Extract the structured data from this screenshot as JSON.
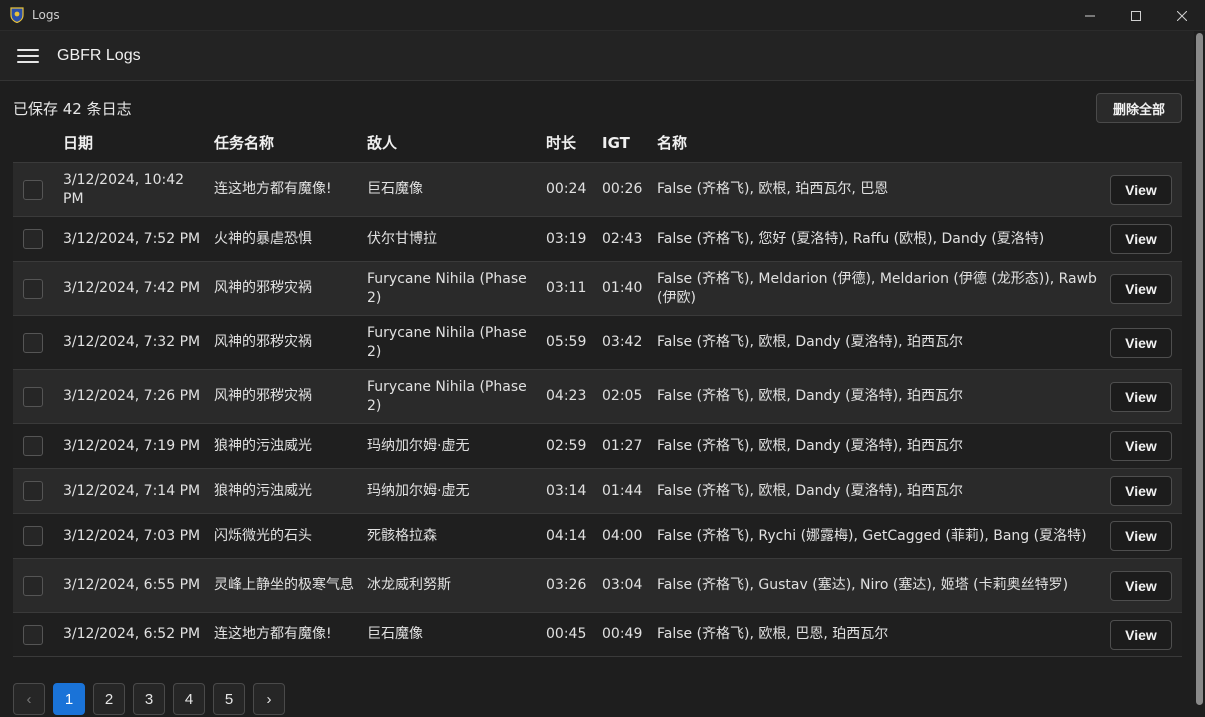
{
  "window": {
    "title": "Logs",
    "controls": {
      "minimize": "—",
      "maximize": "☐",
      "close": "✕"
    }
  },
  "appbar": {
    "title": "GBFR Logs"
  },
  "summary": {
    "saved_count_text": "已保存 42 条日志",
    "delete_all_label": "删除全部"
  },
  "table": {
    "headers": {
      "date": "日期",
      "quest": "任务名称",
      "enemy": "敌人",
      "duration": "时长",
      "igt": "IGT",
      "name": "名称"
    },
    "view_label": "View",
    "rows": [
      {
        "date": "3/12/2024, 10:42 PM",
        "quest": "连这地方都有魔像!",
        "enemy": "巨石魔像",
        "duration": "00:24",
        "igt": "00:26",
        "name": "False (齐格飞), 欧根, 珀西瓦尔, 巴恩"
      },
      {
        "date": "3/12/2024, 7:52 PM",
        "quest": "火神的暴虐恐惧",
        "enemy": "伏尔甘博拉",
        "duration": "03:19",
        "igt": "02:43",
        "name": "False (齐格飞), 您好 (夏洛特), Raffu (欧根), Dandy (夏洛特)"
      },
      {
        "date": "3/12/2024, 7:42 PM",
        "quest": "风神的邪秽灾祸",
        "enemy": "Furycane Nihila (Phase 2)",
        "duration": "03:11",
        "igt": "01:40",
        "name": "False (齐格飞), Meldarion (伊德), Meldarion (伊德 (龙形态)), Rawb (伊欧)"
      },
      {
        "date": "3/12/2024, 7:32 PM",
        "quest": "风神的邪秽灾祸",
        "enemy": "Furycane Nihila (Phase 2)",
        "duration": "05:59",
        "igt": "03:42",
        "name": "False (齐格飞), 欧根, Dandy (夏洛特), 珀西瓦尔"
      },
      {
        "date": "3/12/2024, 7:26 PM",
        "quest": "风神的邪秽灾祸",
        "enemy": "Furycane Nihila (Phase 2)",
        "duration": "04:23",
        "igt": "02:05",
        "name": "False (齐格飞), 欧根, Dandy (夏洛特), 珀西瓦尔"
      },
      {
        "date": "3/12/2024, 7:19 PM",
        "quest": "狼神的污浊威光",
        "enemy": "玛纳加尔姆·虚无",
        "duration": "02:59",
        "igt": "01:27",
        "name": "False (齐格飞), 欧根, Dandy (夏洛特), 珀西瓦尔"
      },
      {
        "date": "3/12/2024, 7:14 PM",
        "quest": "狼神的污浊威光",
        "enemy": "玛纳加尔姆·虚无",
        "duration": "03:14",
        "igt": "01:44",
        "name": "False (齐格飞), 欧根, Dandy (夏洛特), 珀西瓦尔"
      },
      {
        "date": "3/12/2024, 7:03 PM",
        "quest": "闪烁微光的石头",
        "enemy": "死骸格拉森",
        "duration": "04:14",
        "igt": "04:00",
        "name": "False (齐格飞), Rychi (娜露梅), GetCagged (菲莉), Bang (夏洛特)"
      },
      {
        "date": "3/12/2024, 6:55 PM",
        "quest": "灵峰上静坐的极寒气息",
        "enemy": "冰龙威利努斯",
        "duration": "03:26",
        "igt": "03:04",
        "name": "False (齐格飞), Gustav (塞达), Niro (塞达), 姬塔 (卡莉奥丝特罗)"
      },
      {
        "date": "3/12/2024, 6:52 PM",
        "quest": "连这地方都有魔像!",
        "enemy": "巨石魔像",
        "duration": "00:45",
        "igt": "00:49",
        "name": "False (齐格飞), 欧根, 巴恩, 珀西瓦尔"
      }
    ]
  },
  "pagination": {
    "prev": "‹",
    "next": "›",
    "pages": [
      "1",
      "2",
      "3",
      "4",
      "5"
    ],
    "current": "1"
  }
}
